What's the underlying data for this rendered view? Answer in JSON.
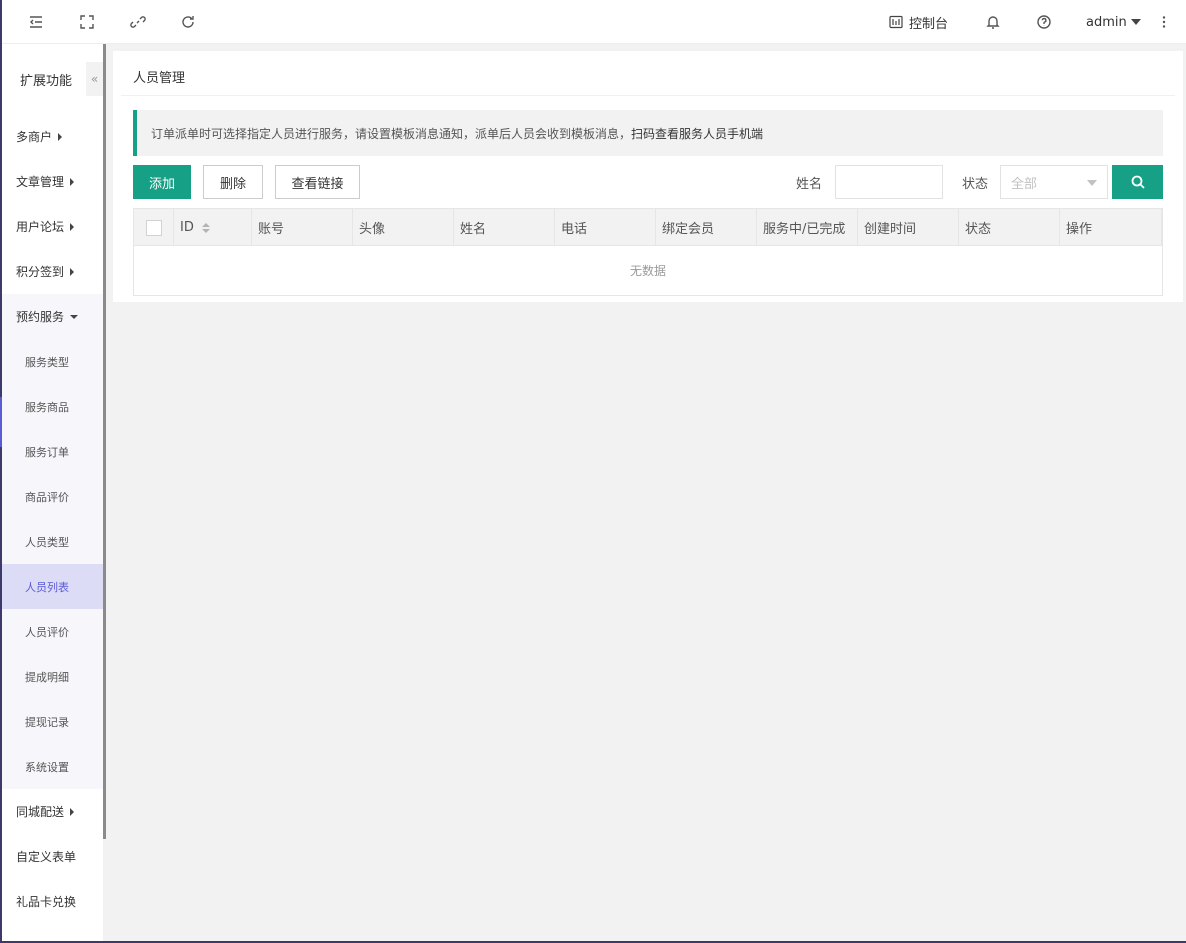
{
  "topbar": {
    "icons": [
      "menu-fold-icon",
      "fullscreen-icon",
      "link-icon",
      "refresh-icon",
      "bell-icon",
      "help-icon",
      "more-vertical-icon"
    ],
    "console_label": "控制台",
    "user_name": "admin"
  },
  "sidebar": {
    "title": "扩展功能",
    "collapse_glyph": "«",
    "items_top": [
      "多商户",
      "文章管理",
      "用户论坛",
      "积分签到"
    ],
    "expanded_label": "预约服务",
    "sub_items": [
      "服务类型",
      "服务商品",
      "服务订单",
      "商品评价",
      "人员类型",
      "人员列表",
      "人员评价",
      "提成明细",
      "提现记录",
      "系统设置"
    ],
    "active_sub": "人员列表",
    "items_bottom": [
      {
        "label": "同城配送",
        "caret": true
      },
      {
        "label": "自定义表单",
        "caret": false
      },
      {
        "label": "礼品卡兑换",
        "caret": false
      }
    ]
  },
  "main": {
    "title": "人员管理",
    "notice_text": "订单派单时可选择指定人员进行服务，请设置模板消息通知，派单后人员会收到模板消息，",
    "notice_strong": "扫码查看服务人员手机端",
    "buttons": {
      "add": "添加",
      "delete": "删除",
      "view_link": "查看链接"
    },
    "filters": {
      "name_label": "姓名",
      "name_value": "",
      "status_label": "状态",
      "status_value": "全部"
    },
    "accent_color": "#16a085",
    "table": {
      "columns": [
        "ID",
        "账号",
        "头像",
        "姓名",
        "电话",
        "绑定会员",
        "服务中/已完成",
        "创建时间",
        "状态",
        "操作"
      ],
      "empty_text": "无数据"
    }
  }
}
